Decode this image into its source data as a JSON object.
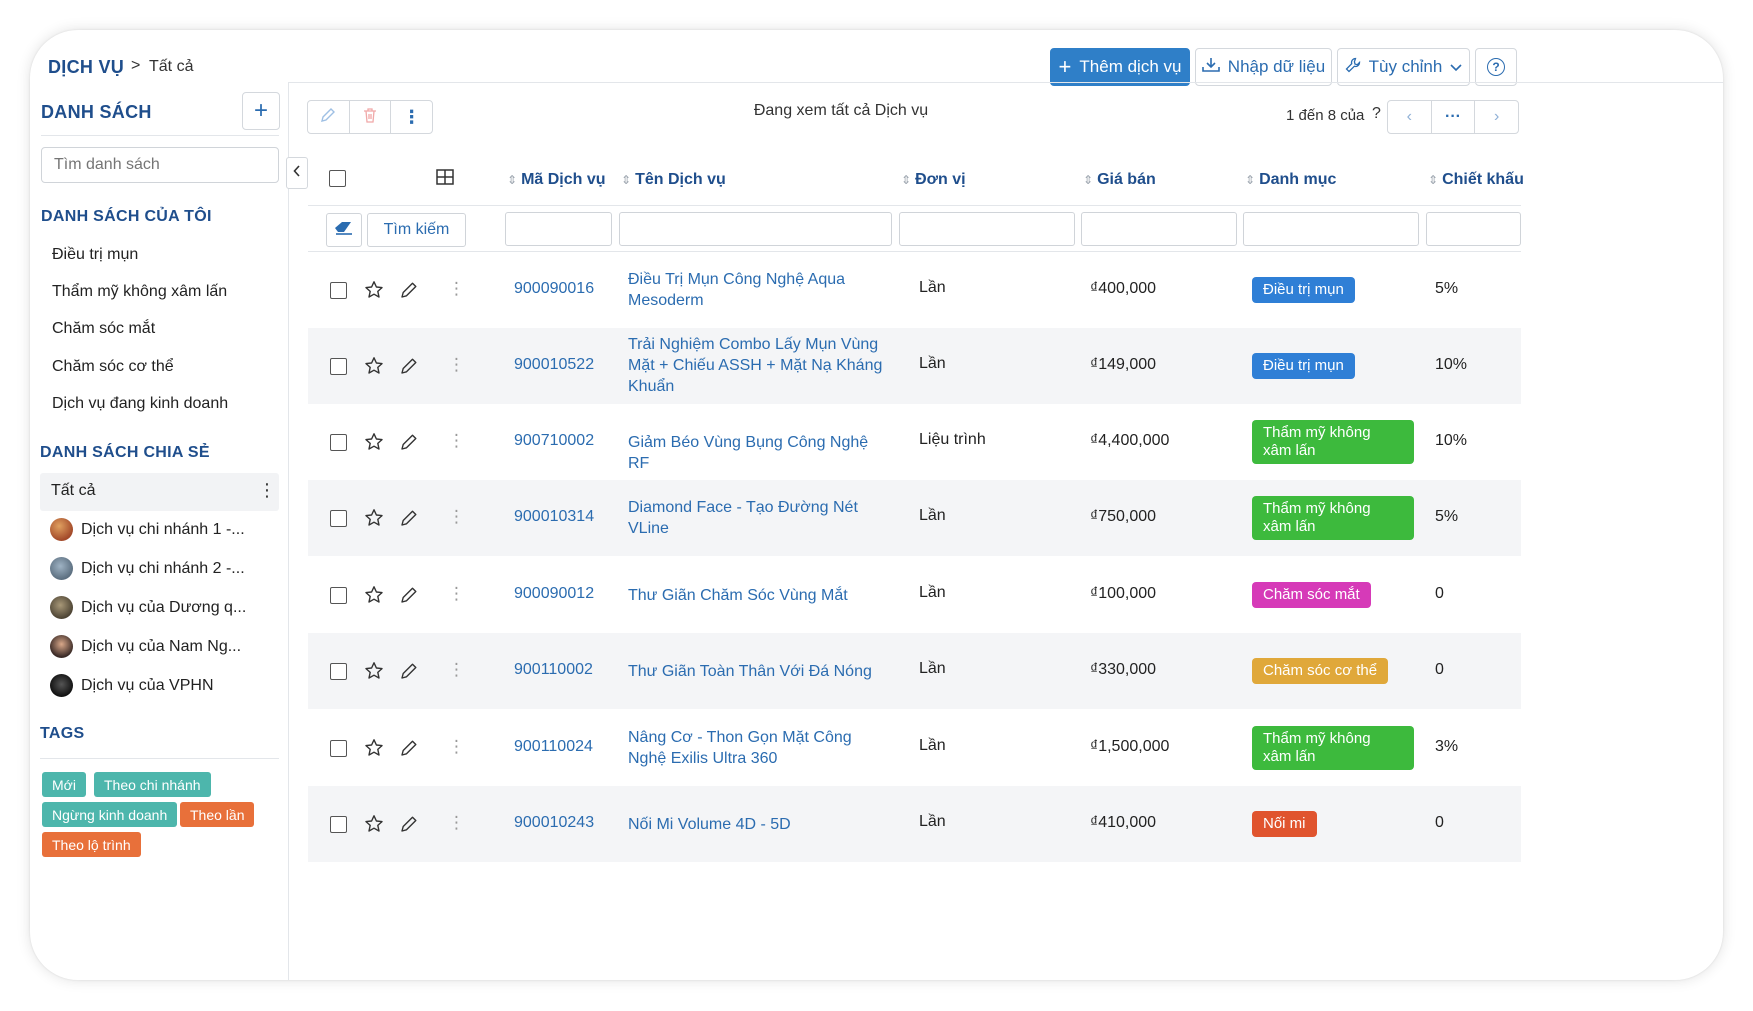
{
  "breadcrumb": {
    "root": "DỊCH VỤ",
    "separator": ">",
    "current": "Tất cả"
  },
  "header": {
    "add_label": "Thêm dịch vụ",
    "import_label": "Nhập dữ liệu",
    "customize_label": "Tùy chỉnh",
    "help_label": "?"
  },
  "sidebar": {
    "list_title": "DANH SÁCH",
    "search_placeholder": "Tìm danh sách",
    "my_lists_title": "DANH SÁCH CỦA TÔI",
    "my_lists": [
      "Điều trị mụn",
      "Thẩm mỹ không xâm lấn",
      "Chăm sóc mắt",
      "Chăm sóc cơ thể",
      "Dịch vụ đang kinh doanh"
    ],
    "shared_title": "DANH SÁCH CHIA SẺ",
    "shared_selected": "Tất cả",
    "shared_lists": [
      "Dịch vụ chi nhánh 1 -...",
      "Dịch vụ chi nhánh 2 -...",
      "Dịch vụ của Dương q...",
      "Dịch vụ của Nam Ng...",
      "Dịch vụ của VPHN"
    ],
    "tags_title": "TAGS",
    "tags": [
      {
        "label": "Mới",
        "color": "#4db6ac"
      },
      {
        "label": "Theo chi nhánh",
        "color": "#4db6ac"
      },
      {
        "label": "Ngừng kinh doanh",
        "color": "#4db6ac"
      },
      {
        "label": "Theo lần",
        "color": "#e8703a"
      },
      {
        "label": "Theo lộ trình",
        "color": "#e8703a"
      }
    ]
  },
  "toolbar": {
    "viewing_text": "Đang xem tất cả Dịch vụ",
    "pager_text": "1 đến 8 của",
    "pager_unknown": "?",
    "pager_more": "···"
  },
  "table": {
    "headers": [
      "Mã Dịch vụ",
      "Tên Dịch vụ",
      "Đơn vị",
      "Giá bán",
      "Danh mục",
      "Chiết khấu"
    ],
    "search_button": "Tìm kiếm",
    "rows": [
      {
        "code": "900090016",
        "name": "Điều Trị Mụn Công Nghệ Aqua Mesoderm",
        "unit": "Lần",
        "price": "₫400,000",
        "category": "Điều trị mụn",
        "category_color": "#2f7fd6",
        "discount": "5%"
      },
      {
        "code": "900010522",
        "name": "Trải Nghiệm Combo Lấy Mụn Vùng Mặt + Chiếu ASSH + Mặt Nạ Kháng Khuẩn",
        "unit": "Lần",
        "price": "₫149,000",
        "category": "Điều trị mụn",
        "category_color": "#2f7fd6",
        "discount": "10%"
      },
      {
        "code": "900710002",
        "name": "Giảm Béo Vùng Bụng Công Nghệ RF",
        "unit": "Liệu trình",
        "price": "₫4,400,000",
        "category": "Thẩm mỹ không xâm lấn",
        "category_color": "#3dba3d",
        "discount": "10%"
      },
      {
        "code": "900010314",
        "name": "Diamond Face - Tạo Đường Nét VLine",
        "unit": "Lần",
        "price": "₫750,000",
        "category": "Thẩm mỹ không xâm lấn",
        "category_color": "#3dba3d",
        "discount": "5%"
      },
      {
        "code": "900090012",
        "name": "Thư Giãn Chăm Sóc Vùng Mắt",
        "unit": "Lần",
        "price": "₫100,000",
        "category": "Chăm sóc mắt",
        "category_color": "#d63ab8",
        "discount": "0"
      },
      {
        "code": "900110002",
        "name": "Thư Giãn Toàn Thân Với Đá Nóng",
        "unit": "Lần",
        "price": "₫330,000",
        "category": "Chăm sóc cơ thể",
        "category_color": "#e0a83a",
        "discount": "0"
      },
      {
        "code": "900110024",
        "name": "Nâng Cơ - Thon Gọn Mặt Công Nghệ Exilis Ultra 360",
        "unit": "Lần",
        "price": "₫1,500,000",
        "category": "Thẩm mỹ không xâm lấn",
        "category_color": "#3dba3d",
        "discount": "3%"
      },
      {
        "code": "900010243",
        "name": "Nối Mi Volume 4D - 5D",
        "unit": "Lần",
        "price": "₫410,000",
        "category": "Nối mi",
        "category_color": "#e0542e",
        "discount": "0"
      }
    ]
  }
}
